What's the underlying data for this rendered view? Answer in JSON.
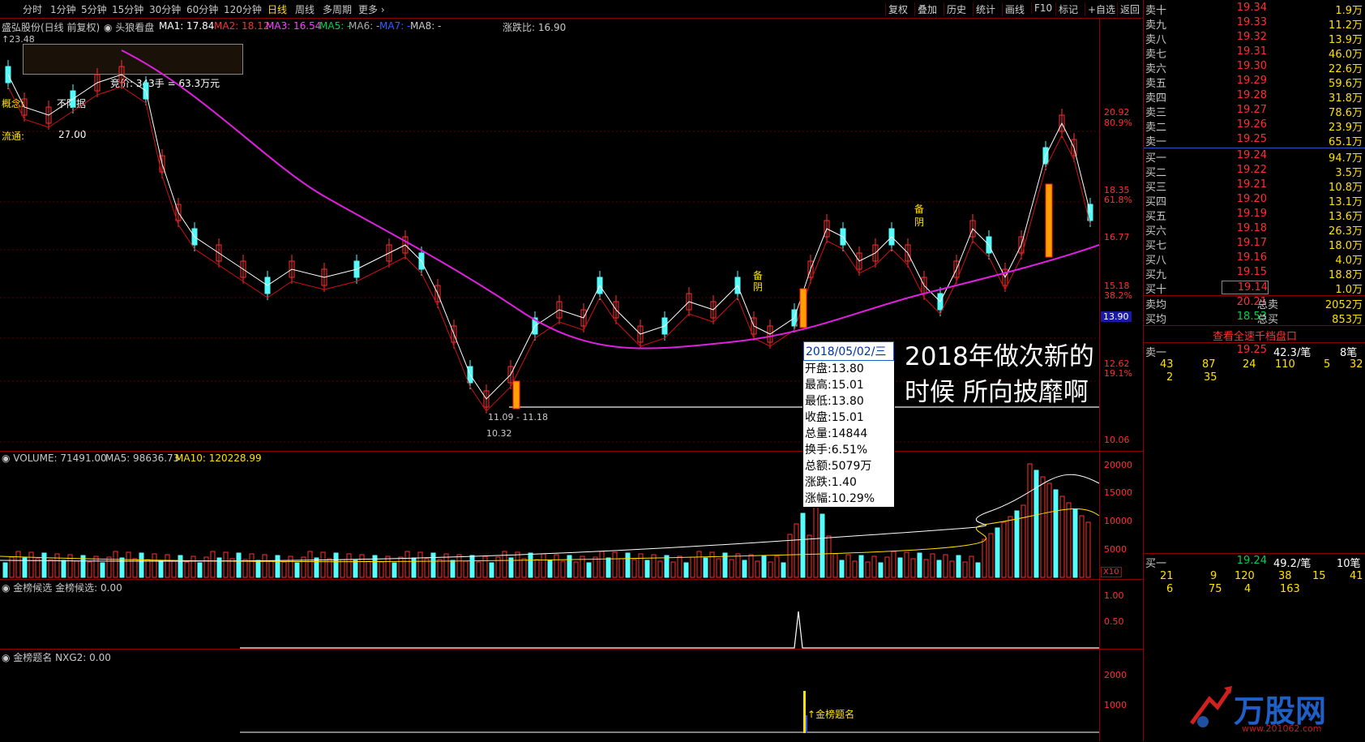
{
  "toolbar": {
    "periods": [
      "分时",
      "1分钟",
      "5分钟",
      "15分钟",
      "30分钟",
      "60分钟",
      "120分钟",
      "日线",
      "周线",
      "多周期",
      "更多"
    ],
    "active_period": "日线",
    "right_buttons": [
      "复权",
      "叠加",
      "历史",
      "统计",
      "画线",
      "F10",
      "标记",
      "+自选",
      "返回"
    ]
  },
  "chart_header": {
    "stock": "盛弘股份(日线 前复权)",
    "indicator": "头狼看盘",
    "ma1": "MA1: 17.84",
    "ma2": "MA2: 18.12",
    "ma3": "MA3: 16.54",
    "ma5": "MA5: -",
    "ma6": "MA6: -",
    "ma7": "MA7: -",
    "ma8": "MA8: -",
    "zhangdie": "涨跌比: 16.90",
    "top_price": "23.48",
    "auction": "竞价: 343手 = 63.3万元",
    "concept_label": "概念:",
    "concept_value": "不限据",
    "float_label": "流通:",
    "float_value": "27.00",
    "low_label": "10.32",
    "range_label": "11.09 - 11.18",
    "bei_yin_1": "备\n阴",
    "bei_yin_2": "备\n阴"
  },
  "price_axis": [
    {
      "v": "20.92",
      "pct": "80.9%"
    },
    {
      "v": "18.35",
      "pct": "61.8%"
    },
    {
      "v": "16.77",
      "pct": ""
    },
    {
      "v": "15.18",
      "pct": "38.2%"
    },
    {
      "v": "13.90",
      "pct": ""
    },
    {
      "v": "12.62",
      "pct": "19.1%"
    },
    {
      "v": "10.06",
      "pct": ""
    }
  ],
  "volume_header": {
    "vol": "VOLUME: 71491.00",
    "ma5": "MA5: 98636.73",
    "ma10": "MA10: 120228.99"
  },
  "volume_axis": [
    "20000",
    "15000",
    "10000",
    "5000"
  ],
  "volume_unit": "X10",
  "jinbang1": {
    "title": "金榜候选",
    "value": "金榜候选: 0.00",
    "axis": [
      "1.00",
      "0.50"
    ]
  },
  "jinbang2": {
    "title": "金榜题名",
    "value": "NXG2: 0.00",
    "axis": [
      "2000",
      "1000"
    ],
    "marker": "金榜题名"
  },
  "tooltip": {
    "date": "2018/05/02/三",
    "rows": [
      "开盘:13.80",
      "最高:15.01",
      "最低:13.80",
      "收盘:15.01",
      "总量:14844",
      "换手:6.51%",
      "总额:5079万",
      "涨跌:1.40",
      "涨幅:10.29%"
    ]
  },
  "annotation": {
    "line1": "2018年做次新的",
    "line2": "时候 所向披靡啊"
  },
  "order_book": {
    "sell": [
      {
        "n": "卖十",
        "p": "19.34",
        "v": "1.9万"
      },
      {
        "n": "卖九",
        "p": "19.33",
        "v": "11.2万"
      },
      {
        "n": "卖八",
        "p": "19.32",
        "v": "13.9万"
      },
      {
        "n": "卖七",
        "p": "19.31",
        "v": "46.0万"
      },
      {
        "n": "卖六",
        "p": "19.30",
        "v": "22.6万"
      },
      {
        "n": "卖五",
        "p": "19.29",
        "v": "59.6万"
      },
      {
        "n": "卖四",
        "p": "19.28",
        "v": "31.8万"
      },
      {
        "n": "卖三",
        "p": "19.27",
        "v": "78.6万"
      },
      {
        "n": "卖二",
        "p": "19.26",
        "v": "23.9万"
      },
      {
        "n": "卖一",
        "p": "19.25",
        "v": "65.1万"
      }
    ],
    "buy": [
      {
        "n": "买一",
        "p": "19.24",
        "v": "94.7万"
      },
      {
        "n": "买二",
        "p": "19.22",
        "v": "3.5万"
      },
      {
        "n": "买三",
        "p": "19.21",
        "v": "10.8万"
      },
      {
        "n": "买四",
        "p": "19.20",
        "v": "13.1万"
      },
      {
        "n": "买五",
        "p": "19.19",
        "v": "13.6万"
      },
      {
        "n": "买六",
        "p": "19.18",
        "v": "26.3万"
      },
      {
        "n": "买七",
        "p": "19.17",
        "v": "18.0万"
      },
      {
        "n": "买八",
        "p": "19.16",
        "v": "4.0万"
      },
      {
        "n": "买九",
        "p": "19.15",
        "v": "18.8万"
      },
      {
        "n": "买十",
        "p": "19.14",
        "v": "1.0万"
      }
    ],
    "avg_sell_label": "卖均",
    "avg_sell": "20.21",
    "total_sell_label": "总卖",
    "total_sell": "2052万",
    "avg_buy_label": "买均",
    "avg_buy": "18.53",
    "total_buy_label": "总买",
    "total_buy": "853万",
    "view_full": "查看全速千档盘口",
    "ask1": {
      "n": "卖一",
      "p": "19.25",
      "v": "42.3/笔",
      "c": "8笔"
    },
    "ask1_orders": [
      "43",
      "87",
      "24",
      "110",
      "5",
      "32",
      "2",
      "35"
    ],
    "bid1": {
      "n": "买一",
      "p": "19.24",
      "v": "49.2/笔",
      "c": "10笔"
    },
    "bid1_orders": [
      "21",
      "9",
      "120",
      "38",
      "15",
      "41",
      "6",
      "75",
      "4",
      "163"
    ]
  },
  "logo": {
    "text": "万股网",
    "url": "www.201062.com"
  }
}
